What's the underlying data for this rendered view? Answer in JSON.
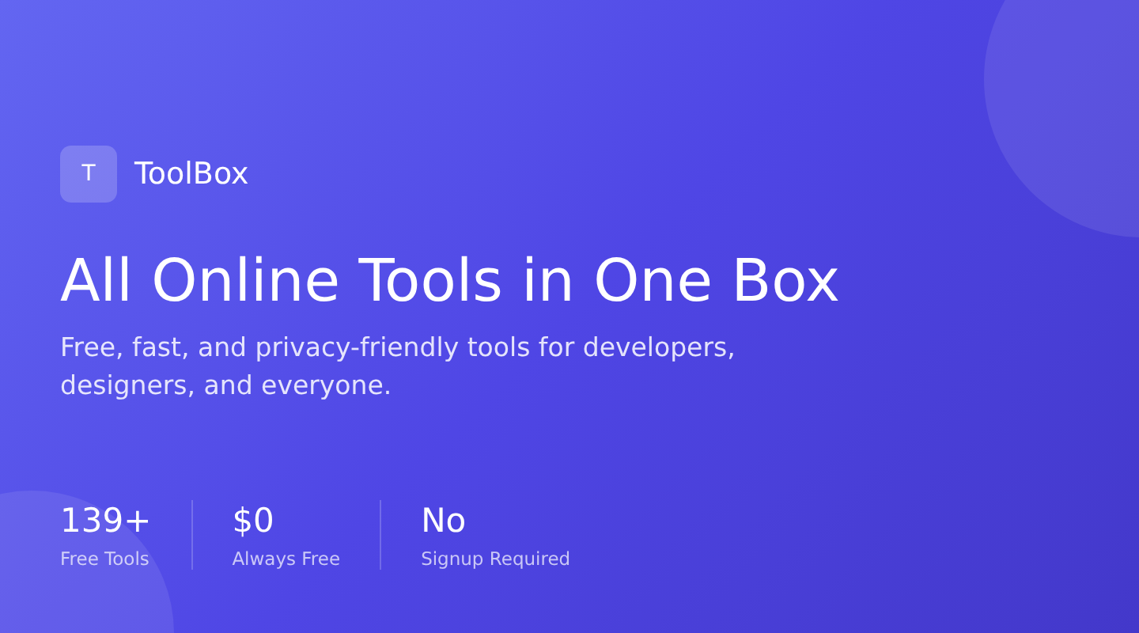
{
  "brand": {
    "logo_letter": "T",
    "name": "ToolBox"
  },
  "headline": "All Online Tools in One Box",
  "subtitle": "Free, fast, and privacy-friendly tools for developers, designers, and everyone.",
  "stats": [
    {
      "value": "139+",
      "label": "Free Tools"
    },
    {
      "value": "$0",
      "label": "Always Free"
    },
    {
      "value": "No",
      "label": "Signup Required"
    }
  ]
}
